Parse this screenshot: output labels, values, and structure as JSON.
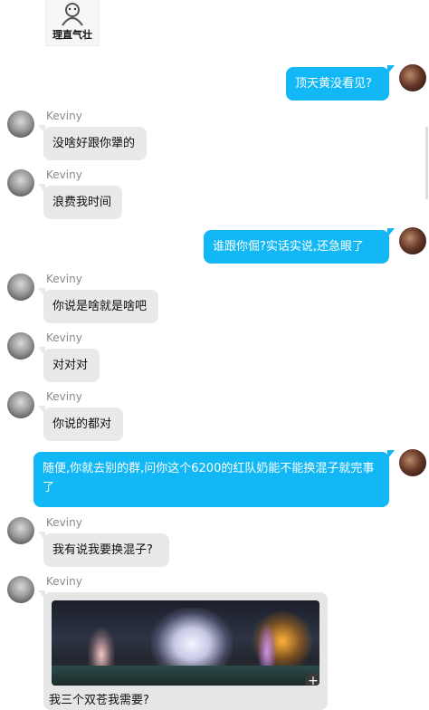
{
  "sticker": {
    "label": "理直气壮",
    "icon": "meme-sticker-icon"
  },
  "messages": [
    {
      "id": "m1",
      "dir": "out",
      "text": "顶天黄没看见?"
    },
    {
      "id": "m2",
      "dir": "in",
      "name": "Keviny",
      "text": "没啥好跟你犟的"
    },
    {
      "id": "m3",
      "dir": "in",
      "name": "Keviny",
      "text": "浪费我时间"
    },
    {
      "id": "m4",
      "dir": "out",
      "text": "谁跟你倔?实话实说,还急眼了"
    },
    {
      "id": "m5",
      "dir": "in",
      "name": "Keviny",
      "text": "你说是啥就是啥吧"
    },
    {
      "id": "m6",
      "dir": "in",
      "name": "Keviny",
      "text": "对对对"
    },
    {
      "id": "m7",
      "dir": "in",
      "name": "Keviny",
      "text": "你说的都对"
    },
    {
      "id": "m8",
      "dir": "out",
      "text": "随便,你就去别的群,问你这个6200的红队奶能不能换混子就完事了"
    },
    {
      "id": "m9",
      "dir": "in",
      "name": "Keviny",
      "text": "我有说我要换混子?"
    },
    {
      "id": "m10",
      "dir": "in",
      "name": "Keviny",
      "type": "image",
      "caption": "我三个双苍我需要?",
      "plus": "+"
    }
  ],
  "colors": {
    "out_bubble": "#12b7f5",
    "in_bubble": "#e9e9e9",
    "name": "#8a8a8a"
  }
}
